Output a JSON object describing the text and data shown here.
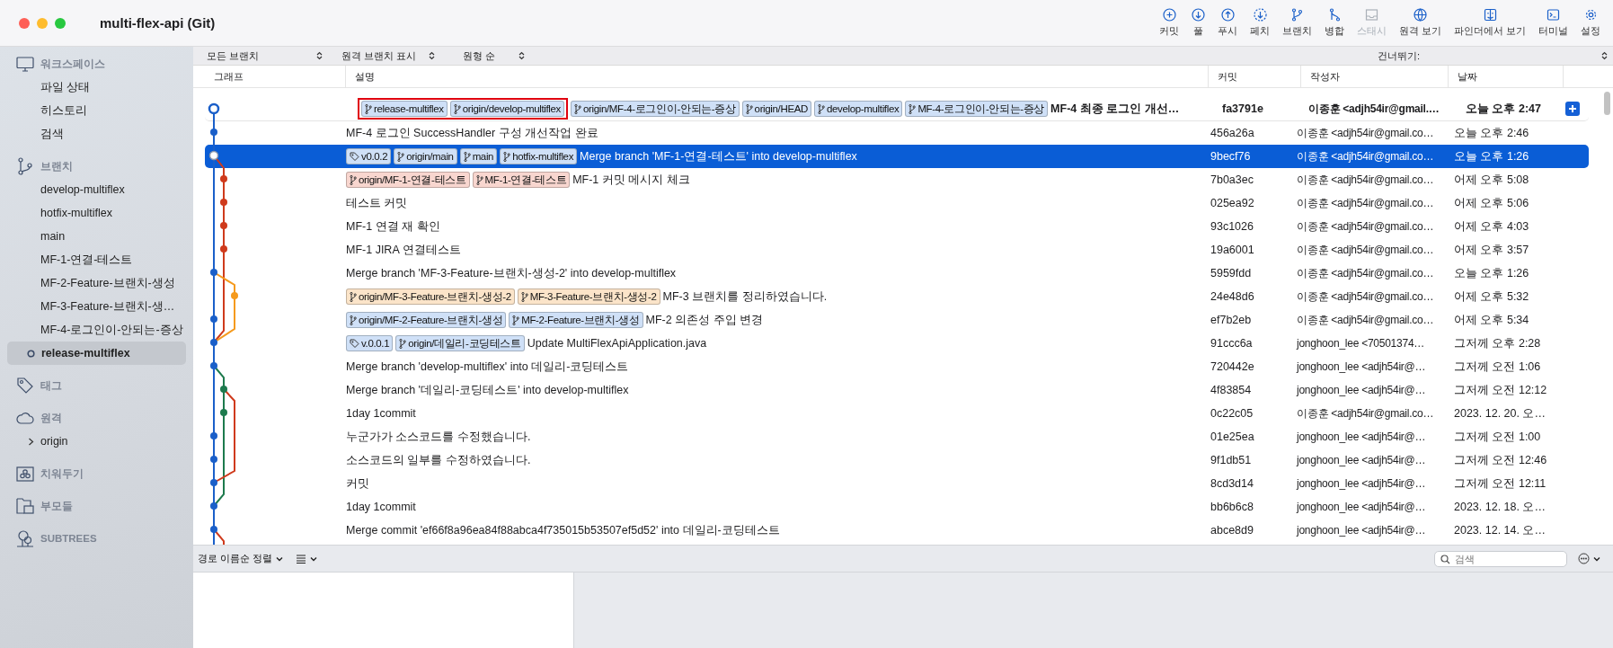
{
  "window": {
    "title": "multi-flex-api (Git)"
  },
  "toolbar": [
    {
      "label": "커밋",
      "kind": "commit",
      "disabled": false
    },
    {
      "label": "풀",
      "kind": "pull",
      "disabled": false
    },
    {
      "label": "푸시",
      "kind": "push",
      "disabled": false
    },
    {
      "label": "페치",
      "kind": "fetch",
      "disabled": false
    },
    {
      "label": "브랜치",
      "kind": "branch",
      "disabled": false
    },
    {
      "label": "병합",
      "kind": "merge",
      "disabled": false
    },
    {
      "label": "스태시",
      "kind": "stash",
      "disabled": true
    },
    {
      "label": "원격 보기",
      "kind": "remote",
      "disabled": false
    },
    {
      "label": "파인더에서 보기",
      "kind": "finder",
      "disabled": false
    },
    {
      "label": "터미널",
      "kind": "terminal",
      "disabled": false
    },
    {
      "label": "설정",
      "kind": "settings",
      "disabled": false
    }
  ],
  "sidebar": {
    "sections": [
      {
        "title": "워크스페이스",
        "kind": "workspace",
        "items": [
          {
            "label": "파일 상태",
            "selected": false
          },
          {
            "label": "히스토리",
            "selected": false
          },
          {
            "label": "검색",
            "selected": false
          }
        ]
      },
      {
        "title": "브랜치",
        "kind": "branch",
        "items": [
          {
            "label": "develop-multiflex",
            "selected": false
          },
          {
            "label": "hotfix-multiflex",
            "selected": false
          },
          {
            "label": "main",
            "selected": false
          },
          {
            "label": "MF-1-연결-테스트",
            "selected": false
          },
          {
            "label": "MF-2-Feature-브랜치-생성",
            "selected": false
          },
          {
            "label": "MF-3-Feature-브랜치-생…",
            "selected": false
          },
          {
            "label": "MF-4-로그인이-안되는-증상",
            "selected": false
          },
          {
            "label": "release-multiflex",
            "selected": true
          }
        ]
      },
      {
        "title": "태그",
        "kind": "tag"
      },
      {
        "title": "원격",
        "kind": "remote",
        "items": [
          {
            "label": "origin",
            "selected": false,
            "expanded": false
          }
        ]
      },
      {
        "title": "치워두기",
        "kind": "stash"
      },
      {
        "title": "부모들",
        "kind": "submodule"
      },
      {
        "title": "SUBTREES",
        "kind": "subtree"
      }
    ]
  },
  "filters": [
    {
      "label": "모든 브랜치"
    },
    {
      "label": "원격 브랜치 표시"
    },
    {
      "label": "원형 순"
    }
  ],
  "jump": {
    "label": "건너뛰기:"
  },
  "table": {
    "columns": [
      "그래프",
      "설명",
      "커밋",
      "작성자",
      "날짜"
    ],
    "rows": [
      {
        "refs": [
          {
            "label": "release-multiflex",
            "kind": "branch",
            "color": "#cfe0f7",
            "marked": true
          },
          {
            "label": "origin/develop-multiflex",
            "kind": "branch",
            "color": "#cfe0f7",
            "marked": true
          },
          {
            "label": "origin/MF-4-로그인이-안되는-증상",
            "kind": "branch",
            "color": "#cfe0f7",
            "marked": false
          },
          {
            "label": "origin/HEAD",
            "kind": "branch",
            "color": "#cfe0f7",
            "marked": false
          },
          {
            "label": "develop-multiflex",
            "kind": "branch",
            "color": "#cfe0f7",
            "marked": false
          },
          {
            "label": "MF-4-로그인이-안되는-증상",
            "kind": "branch",
            "color": "#cfe0f7",
            "marked": false
          }
        ],
        "description": "MF-4 최종 로그인 개선…",
        "commit": "fa3791e",
        "author": "이종훈 <adjh54ir@gmail.…",
        "date": "오늘 오후 2:47",
        "head": true,
        "selected": false
      },
      {
        "description": "MF-4 로그인 SuccessHandler 구성 개선작업 완료",
        "commit": "456a26a",
        "author": "이종훈 <adjh54ir@gmail.co…",
        "date": "오늘 오후 2:46",
        "head": false,
        "selected": false
      },
      {
        "refs": [
          {
            "label": "v0.0.2",
            "kind": "tag",
            "color": "#cfe0f7",
            "marked": false
          },
          {
            "label": "origin/main",
            "kind": "branch",
            "color": "#cfe0f7",
            "marked": false
          },
          {
            "label": "main",
            "kind": "branch",
            "color": "#cfe0f7",
            "marked": false
          },
          {
            "label": "hotfix-multiflex",
            "kind": "branch",
            "color": "#cfe0f7",
            "marked": false
          }
        ],
        "description": "Merge branch 'MF-1-연결-테스트' into develop-multiflex",
        "commit": "9becf76",
        "author": "이종훈 <adjh54ir@gmail.co…",
        "date": "오늘 오후 1:26",
        "head": false,
        "selected": true
      },
      {
        "refs": [
          {
            "label": "origin/MF-1-연결-테스트",
            "kind": "branch",
            "color": "#f8d6cf",
            "marked": false
          },
          {
            "label": "MF-1-연결-테스트",
            "kind": "branch",
            "color": "#f8d6cf",
            "marked": false
          }
        ],
        "description": "MF-1 커밋 메시지 체크",
        "commit": "7b0a3ec",
        "author": "이종훈 <adjh54ir@gmail.co…",
        "date": "어제 오후 5:08",
        "head": false,
        "selected": false
      },
      {
        "description": "테스트 커밋",
        "commit": "025ea92",
        "author": "이종훈 <adjh54ir@gmail.co…",
        "date": "어제 오후 5:06",
        "head": false,
        "selected": false
      },
      {
        "description": "MF-1 연결 재 확인",
        "commit": "93c1026",
        "author": "이종훈 <adjh54ir@gmail.co…",
        "date": "어제 오후 4:03",
        "head": false,
        "selected": false
      },
      {
        "description": "MF-1 JIRA 연결테스트",
        "commit": "19a6001",
        "author": "이종훈 <adjh54ir@gmail.co…",
        "date": "어제 오후 3:57",
        "head": false,
        "selected": false
      },
      {
        "description": "Merge branch 'MF-3-Feature-브랜치-생성-2' into develop-multiflex",
        "commit": "5959fdd",
        "author": "이종훈 <adjh54ir@gmail.co…",
        "date": "오늘 오후 1:26",
        "head": false,
        "selected": false
      },
      {
        "refs": [
          {
            "label": "origin/MF-3-Feature-브랜치-생성-2",
            "kind": "branch",
            "color": "#fbe4c9",
            "marked": false
          },
          {
            "label": "MF-3-Feature-브랜치-생성-2",
            "kind": "branch",
            "color": "#fbe4c9",
            "marked": false
          }
        ],
        "description": "MF-3 브랜치를 정리하였습니다.",
        "commit": "24e48d6",
        "author": "이종훈 <adjh54ir@gmail.co…",
        "date": "어제 오후 5:32",
        "head": false,
        "selected": false
      },
      {
        "refs": [
          {
            "label": "origin/MF-2-Feature-브랜치-생성",
            "kind": "branch",
            "color": "#cfe0f7",
            "marked": false
          },
          {
            "label": "MF-2-Feature-브랜치-생성",
            "kind": "branch",
            "color": "#cfe0f7",
            "marked": false
          }
        ],
        "description": "MF-2 의존성 주입 변경",
        "commit": "ef7b2eb",
        "author": "이종훈 <adjh54ir@gmail.co…",
        "date": "어제 오후 5:34",
        "head": false,
        "selected": false
      },
      {
        "refs": [
          {
            "label": "v.0.0.1",
            "kind": "tag",
            "color": "#cfe0f7",
            "marked": false
          },
          {
            "label": "origin/데일리-코딩테스트",
            "kind": "branch",
            "color": "#cfe0f7",
            "marked": false
          }
        ],
        "description": "Update MultiFlexApiApplication.java",
        "commit": "91ccc6a",
        "author": "jonghoon_lee <70501374…",
        "date": "그저께 오후 2:28",
        "head": false,
        "selected": false
      },
      {
        "description": "Merge branch 'develop-multiflex' into 데일리-코딩테스트",
        "commit": "720442e",
        "author": "jonghoon_lee <adjh54ir@…",
        "date": "그저께 오전 1:06",
        "head": false,
        "selected": false
      },
      {
        "description": "Merge branch '데일리-코딩테스트' into develop-multiflex",
        "commit": "4f83854",
        "author": "jonghoon_lee <adjh54ir@…",
        "date": "그저께 오전 12:12",
        "head": false,
        "selected": false
      },
      {
        "description": "1day 1commit",
        "commit": "0c22c05",
        "author": "이종훈 <adjh54ir@gmail.co…",
        "date": "2023. 12. 20. 오…",
        "head": false,
        "selected": false
      },
      {
        "description": "누군가가 소스코드를 수정했습니다.",
        "commit": "01e25ea",
        "author": "jonghoon_lee <adjh54ir@…",
        "date": "그저께 오전 1:00",
        "head": false,
        "selected": false
      },
      {
        "description": "소스코드의 일부를 수정하였습니다.",
        "commit": "9f1db51",
        "author": "jonghoon_lee <adjh54ir@…",
        "date": "그저께 오전 12:46",
        "head": false,
        "selected": false
      },
      {
        "description": "커밋",
        "commit": "8cd3d14",
        "author": "jonghoon_lee <adjh54ir@…",
        "date": "그저께 오전 12:11",
        "head": false,
        "selected": false
      },
      {
        "description": "1day 1commit",
        "commit": "bb6b6c8",
        "author": "jonghoon_lee <adjh54ir@…",
        "date": "2023. 12. 18. 오…",
        "head": false,
        "selected": false
      },
      {
        "description": "Merge commit 'ef66f8a96ea84f88abca4f735015b53507ef5d52' into 데일리-코딩테스트",
        "commit": "abce8d9",
        "author": "jonghoon_lee <adjh54ir@…",
        "date": "2023. 12. 14. 오…",
        "head": false,
        "selected": false
      }
    ]
  },
  "bottom": {
    "sort": {
      "label": "경로 이름순 정렬"
    },
    "search": {
      "placeholder": "검색"
    }
  }
}
